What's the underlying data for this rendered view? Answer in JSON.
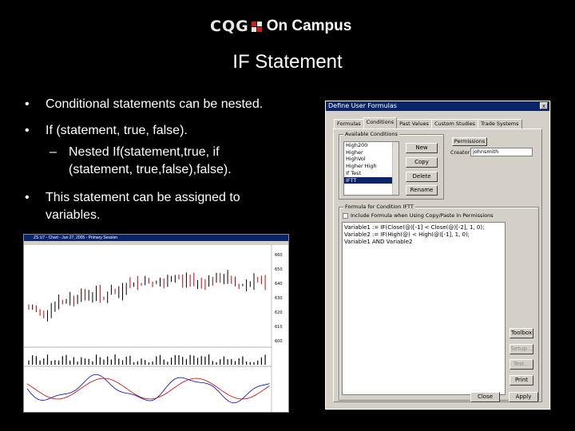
{
  "logo": {
    "brand": "CQG",
    "product": "On Campus"
  },
  "slide": {
    "title": "IF Statement",
    "bullet_glyph": "•",
    "bullets": [
      "Conditional statements can be nested.",
      "If (statement, true, false).",
      "This statement can be assigned to variables."
    ],
    "sub_dash": "–",
    "sub_bullet": "Nested If(statement,true, if (statement, true,false),false)."
  },
  "dialog": {
    "title": "Define User Formulas",
    "close": "x",
    "tabs": [
      "Formulas",
      "Conditions",
      "Past Values",
      "Custom Studies",
      "Trade Systems"
    ],
    "available_group": "Available Conditions",
    "conditions": [
      "High200",
      "Higher",
      "HighVol",
      "Higher High",
      "If Test",
      "IFTT"
    ],
    "selected_condition": "IFTT",
    "buttons": {
      "new": "New",
      "copy": "Copy",
      "delete": "Delete",
      "rename": "Rename",
      "permissions": "Permissions",
      "toolbox": "Toolbox",
      "setup": "Setup...",
      "test": "Test...",
      "print": "Print",
      "close": "Close",
      "apply": "Apply"
    },
    "creator_label": "Creator",
    "creator_value": "johnsmith",
    "formula_group": "Formula for Condition IFTT",
    "checkbox_label": "Include Formula when Using Copy/Paste in Permissions",
    "formula_lines": [
      "Variable1 := IF(Close(@)[-1] < Close(@)[-2], 1, 0);",
      "Variable2 := IF(High(@) < High(@)[-1], 1, 0);",
      "",
      "Variable1 AND Variable2"
    ]
  },
  "chart": {
    "window_title": "ZS U7 - Chart - Jun 27, 2005 - Primary Session",
    "price_labels": [
      "660",
      "650",
      "640",
      "630",
      "620",
      "610",
      "600"
    ],
    "colors": {
      "up": "#000000",
      "down": "#cc0000",
      "line1": "#0000cc",
      "line2": "#cc0000"
    }
  }
}
